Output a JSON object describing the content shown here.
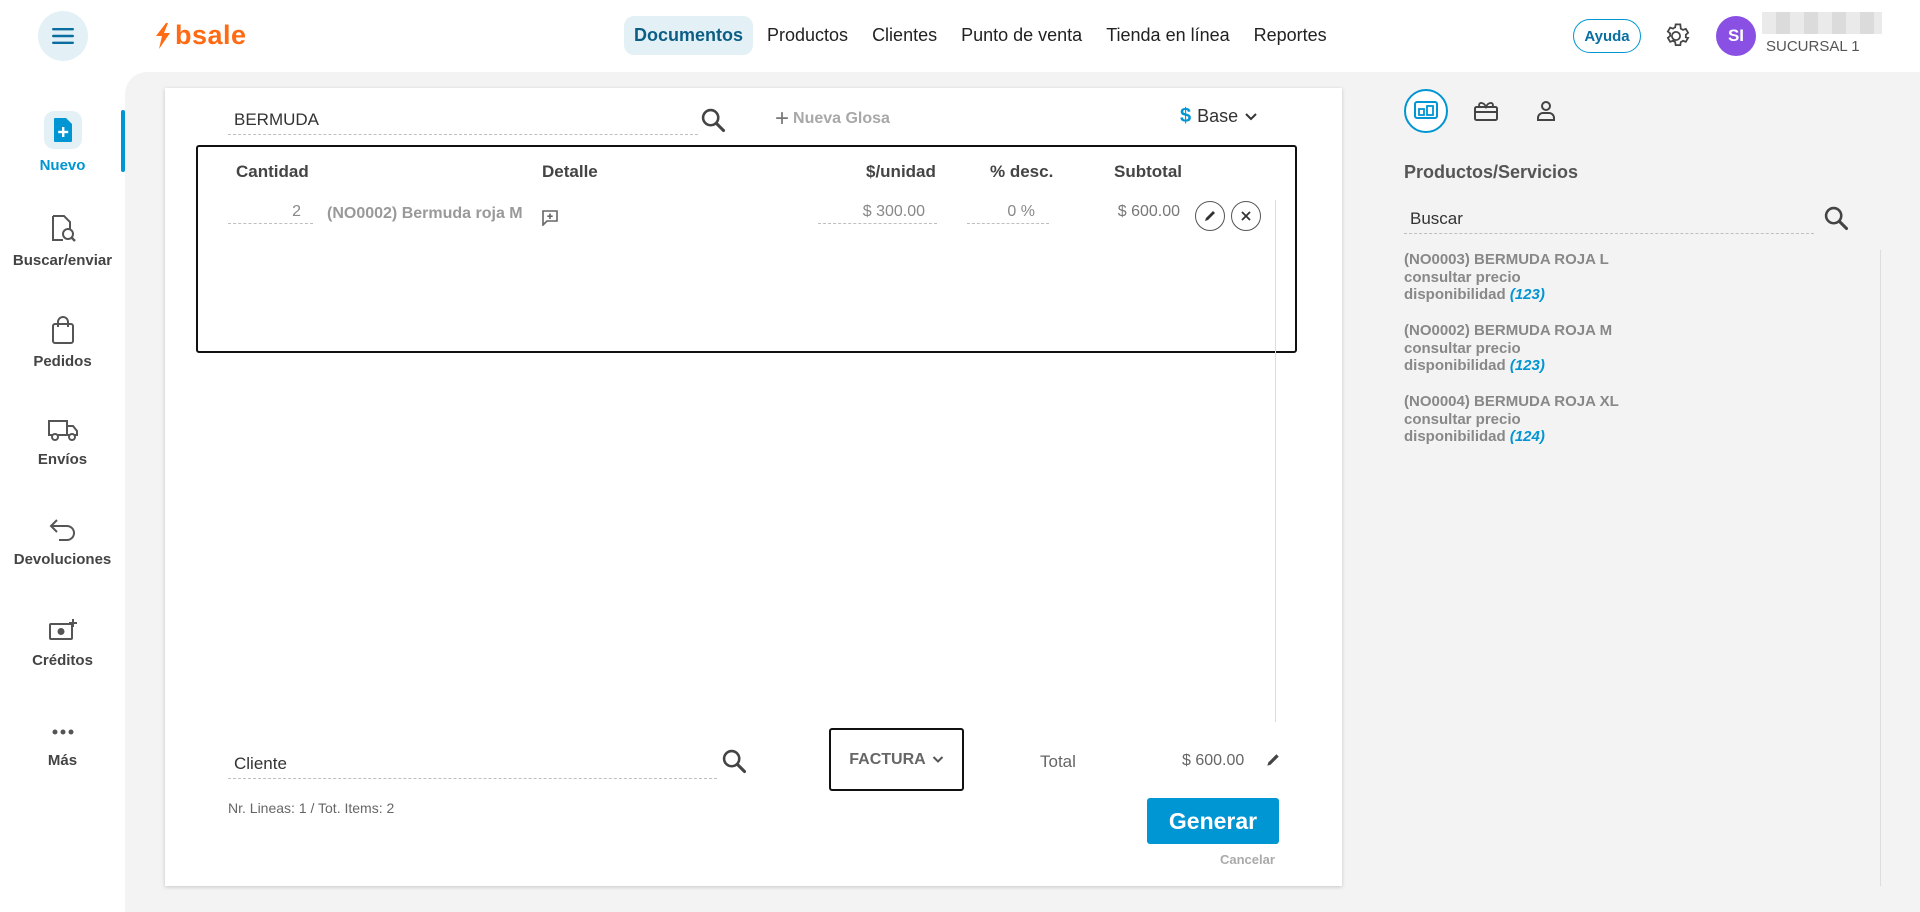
{
  "app": {
    "brand": "bsale"
  },
  "nav": {
    "items": [
      {
        "label": "Documentos",
        "active": true
      },
      {
        "label": "Productos",
        "active": false
      },
      {
        "label": "Clientes",
        "active": false
      },
      {
        "label": "Punto de venta",
        "active": false
      },
      {
        "label": "Tienda en línea",
        "active": false
      },
      {
        "label": "Reportes",
        "active": false
      }
    ]
  },
  "header": {
    "help_label": "Ayuda",
    "avatar_initials": "SI",
    "branch": "SUCURSAL 1"
  },
  "sidebar": {
    "items": [
      {
        "label": "Nuevo",
        "icon": "new-document-icon",
        "active": true
      },
      {
        "label": "Buscar/enviar",
        "icon": "search-document-icon",
        "active": false
      },
      {
        "label": "Pedidos",
        "icon": "shopping-bag-icon",
        "active": false
      },
      {
        "label": "Envíos",
        "icon": "truck-icon",
        "active": false
      },
      {
        "label": "Devoluciones",
        "icon": "return-arrow-icon",
        "active": false
      },
      {
        "label": "Créditos",
        "icon": "cash-add-icon",
        "active": false
      },
      {
        "label": "Más",
        "icon": "more-dots-icon",
        "active": false
      }
    ]
  },
  "document": {
    "search_value": "BERMUDA",
    "new_gloss_label": "Nueva Glosa",
    "price_list_label": "Base",
    "columns": {
      "quantity": "Cantidad",
      "detail": "Detalle",
      "unit_price": "$/unidad",
      "discount": "% desc.",
      "subtotal": "Subtotal"
    },
    "rows": [
      {
        "quantity": "2",
        "detail": "(NO0002) Bermuda roja M",
        "unit_price": "$ 300.00",
        "discount": "0 %",
        "subtotal": "$ 600.00"
      }
    ],
    "client_placeholder": "Cliente",
    "doc_type": "FACTURA",
    "total_label": "Total",
    "total_value": "$ 600.00",
    "summary": "Nr. Lineas: 1 / Tot. Items: 2",
    "generate_label": "Generar",
    "cancel_label": "Cancelar"
  },
  "right_panel": {
    "title": "Productos/Servicios",
    "search_placeholder": "Buscar",
    "products": [
      {
        "name": "(NO0003) BERMUDA ROJA L",
        "price": "consultar precio",
        "availability_label": "disponibilidad",
        "stock": "(123)"
      },
      {
        "name": "(NO0002) BERMUDA ROJA M",
        "price": "consultar precio",
        "availability_label": "disponibilidad",
        "stock": "(123)"
      },
      {
        "name": "(NO0004) BERMUDA ROJA XL",
        "price": "consultar precio",
        "availability_label": "disponibilidad",
        "stock": "(124)"
      }
    ]
  },
  "colors": {
    "accent": "#0095d3",
    "brand": "#ff6a13",
    "avatar": "#8a4fe3",
    "active_bg": "#e3f1f7"
  }
}
